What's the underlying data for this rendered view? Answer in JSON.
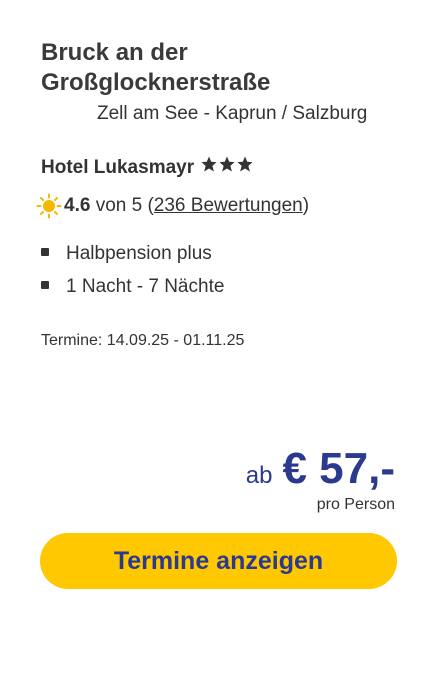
{
  "offer": {
    "title": "Bruck an der Großglocknerstraße",
    "location": "Zell am See - Kaprun / Salzburg",
    "hotel_name": "Hotel Lukasmayr",
    "hotel_stars": 3,
    "rating": {
      "icon": "sun-icon",
      "score": "4.6",
      "of_text": " von 5 (",
      "reviews_link": "236 Bewertungen",
      "close_paren": ")"
    },
    "features": [
      "Halbpension plus",
      "1 Nacht - 7 Nächte"
    ],
    "dates": "Termine: 14.09.25 - 01.11.25",
    "price": {
      "prefix": "ab",
      "amount": "€ 57,-",
      "per_person": "pro Person"
    },
    "cta_label": "Termine anzeigen"
  },
  "colors": {
    "accent_blue": "#2b3a8f",
    "button_yellow": "#ffc800",
    "text": "#333333",
    "sun_yellow": "#f5b700"
  }
}
